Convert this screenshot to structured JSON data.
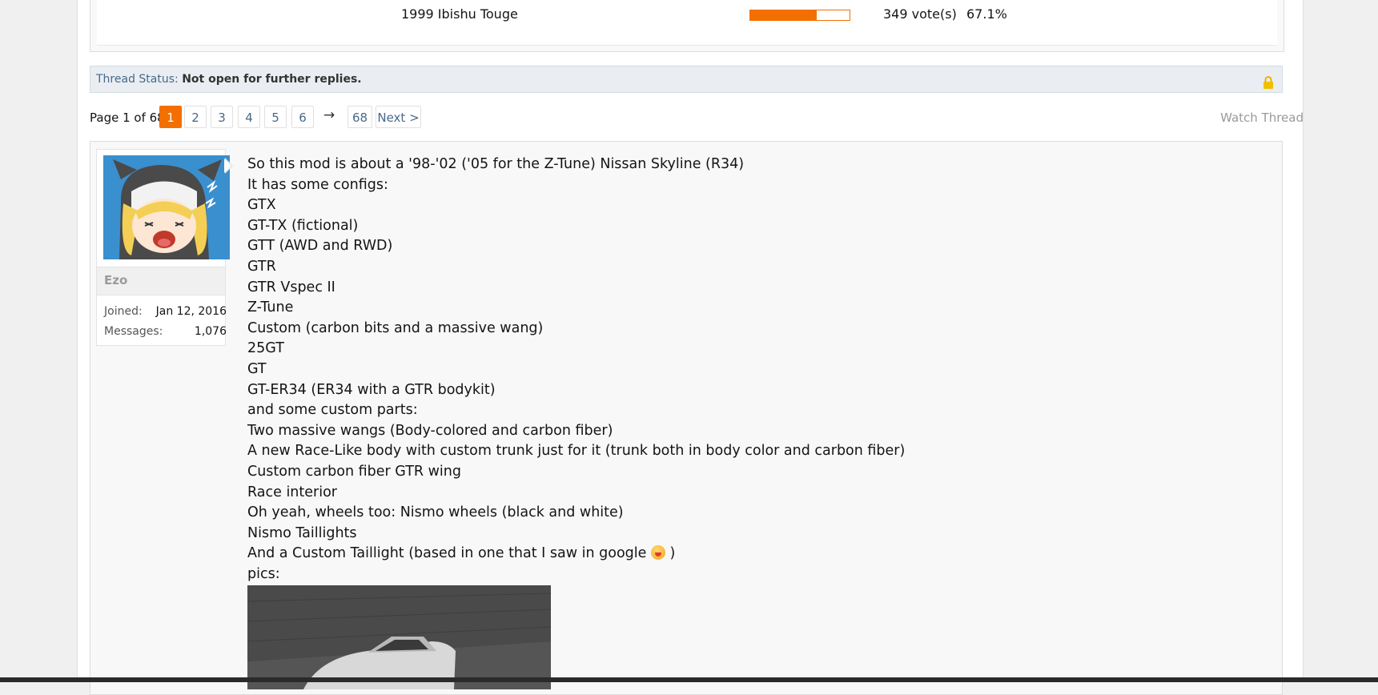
{
  "poll": {
    "option": "1999 Ibishu Touge",
    "votes": "349 vote(s)",
    "percent_text": "67.1%",
    "fill_fraction": 0.671
  },
  "thread_status": {
    "label": "Thread Status:",
    "value": "Not open for further replies."
  },
  "pagination": {
    "info": "Page 1 of 68",
    "pages": [
      "1",
      "2",
      "3",
      "4",
      "5",
      "6"
    ],
    "skip": "→",
    "last": "68",
    "next": "Next >"
  },
  "watch_thread": "Watch Thread",
  "user": {
    "name": "Ezo",
    "joined_label": "Joined:",
    "joined_value": "Jan 12, 2016",
    "messages_label": "Messages:",
    "messages_value": "1,076"
  },
  "message_lines": [
    "So this mod is about a '98-'02 ('05 for the Z-Tune) Nissan Skyline (R34)",
    "It has some configs:",
    "GTX",
    "GT-TX (fictional)",
    "GTT (AWD and RWD)",
    "GTR",
    "GTR Vspec II",
    "Z-Tune",
    "Custom (carbon bits and a massive wang)",
    "25GT",
    "GT",
    "GT-ER34 (ER34 with a GTR bodykit)",
    "and some custom parts:",
    "Two massive wangs (Body-colored and carbon fiber)",
    "A new Race-Like body with custom trunk just for it (trunk both in body color and carbon fiber)",
    "Custom carbon fiber GTR wing",
    "Race interior",
    "Oh yeah, wheels too: Nismo wheels (black and white)",
    "Nismo Taillights"
  ],
  "message_emoji_line": {
    "before": "And a Custom Taillight (based in one that I saw in google ",
    "after": " )"
  },
  "message_pics": "pics:",
  "colors": {
    "accent": "#f36f00",
    "link": "#47698a",
    "status_bg": "#eaeef2"
  }
}
